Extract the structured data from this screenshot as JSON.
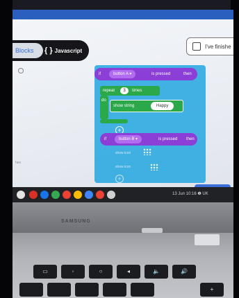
{
  "editor": {
    "tab_blocks": "Blocks",
    "tab_javascript": "Javascript",
    "javascript_icon": "{ }",
    "finish_button": "I've finishe",
    "side_text": "hen"
  },
  "blocks": {
    "event1_if": "if",
    "event1_button": "button",
    "event1_key": "A ▾",
    "event1_pressed": "is pressed",
    "event1_then": "then",
    "repeat_label": "repeat",
    "repeat_count": "3",
    "repeat_times": "times",
    "do_label": "do",
    "show_string_label": "show string",
    "show_string_value": "Happy",
    "event2_if": "if",
    "event2_button": "button",
    "event2_key": "B ▾",
    "event2_pressed": "is pressed",
    "event2_then": "then",
    "dim1": "show icon",
    "dim2": "show icon"
  },
  "zoom": {
    "minus": "−",
    "plus": "+",
    "fit": "⊕"
  },
  "taskbar": {
    "status": "13 Jun  10:16 ❶ UK"
  },
  "laptop": {
    "brand": "SAMSUNG"
  },
  "keys": {
    "row1": [
      "▭",
      "◦",
      "○",
      "◂",
      "🔈",
      "🔊"
    ],
    "row2": [
      "",
      "",
      "",
      "",
      "",
      "+"
    ]
  },
  "colors": {
    "event_purple": "#8b3fd6",
    "loop_green": "#2aa84a",
    "workspace_blue": "#23a6e0",
    "accent_blue": "#3b6fd8"
  }
}
